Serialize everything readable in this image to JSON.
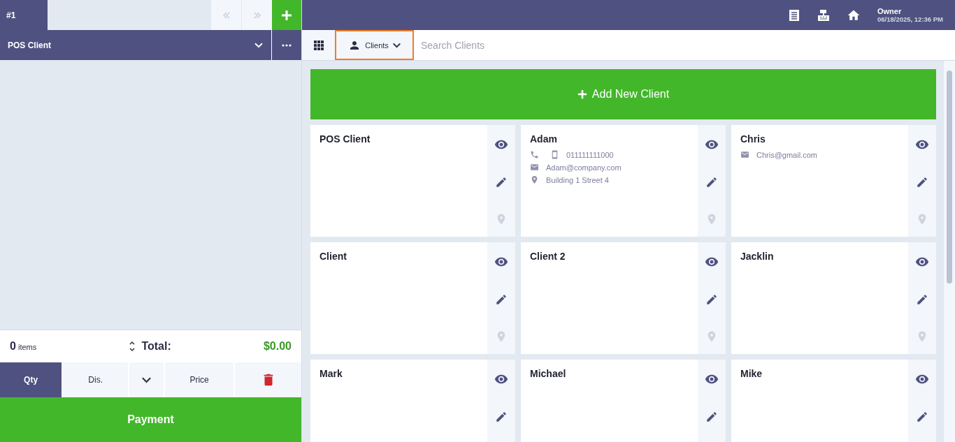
{
  "order_tabs": [
    {
      "label": "#1",
      "selected": true
    }
  ],
  "nav": {
    "prev_disabled": true,
    "next_disabled": true
  },
  "user": {
    "name": "Owner",
    "datetime": "06/18/2025, 12:36 PM"
  },
  "customer": {
    "name": "POS Client"
  },
  "mode_dropdown": {
    "label": "Clients",
    "highlighted": true
  },
  "search": {
    "placeholder": "Search Clients"
  },
  "summary": {
    "count": "0",
    "count_label": "items",
    "total_label": "Total:",
    "total": "$0.00"
  },
  "keypad": [
    {
      "kind": "text",
      "label": "Qty",
      "selected": true
    },
    {
      "kind": "text",
      "label": "Dis.",
      "selected": false
    },
    {
      "kind": "caret",
      "selected": false
    },
    {
      "kind": "text",
      "label": "Price",
      "selected": false
    },
    {
      "kind": "delete",
      "selected": false
    }
  ],
  "payment_button": "Payment",
  "add_client_button": "Add New Client",
  "clients": [
    {
      "name": "POS Client",
      "map_available": false
    },
    {
      "name": "Adam",
      "map_available": false,
      "contacts": [
        {
          "kind": "phone",
          "text": "011111111000"
        },
        {
          "kind": "email",
          "text": "Adam@company.com"
        },
        {
          "kind": "address",
          "text": "Building 1 Street 4"
        }
      ]
    },
    {
      "name": "Chris",
      "map_available": false,
      "contacts": [
        {
          "kind": "email",
          "text": "Chris@gmail.com"
        }
      ]
    },
    {
      "name": "Client",
      "map_available": false
    },
    {
      "name": "Client 2",
      "map_available": false
    },
    {
      "name": "Jacklin",
      "map_available": false
    },
    {
      "name": "Mark"
    },
    {
      "name": "Michael"
    },
    {
      "name": "Mike"
    }
  ]
}
